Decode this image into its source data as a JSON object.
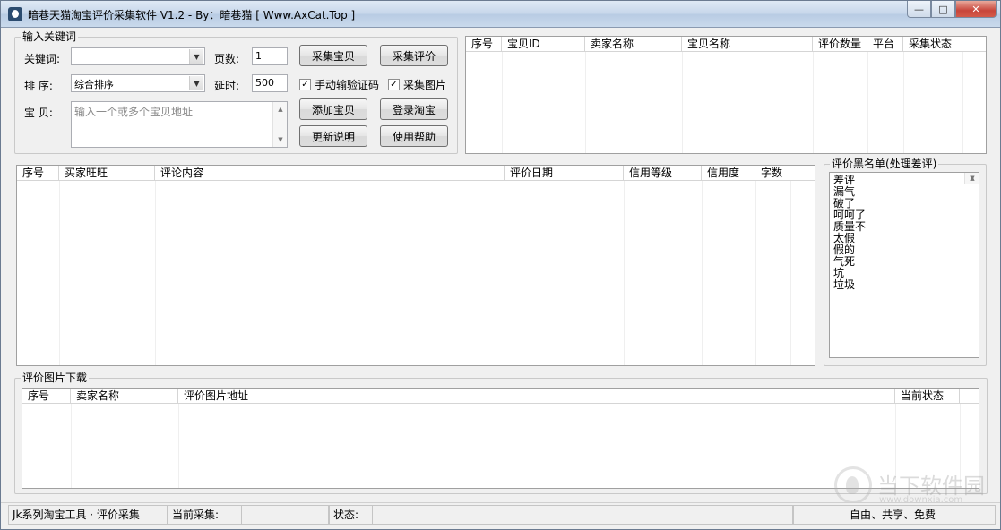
{
  "window": {
    "title": "暗巷天猫淘宝评价采集软件 V1.2 - By：暗巷猫 [ Www.AxCat.Top ]",
    "minimize": "—",
    "maximize": "□",
    "close": "✕"
  },
  "keywords_group": {
    "legend": "输入关键词",
    "keyword_label": "关键词:",
    "keyword_value": "",
    "pages_label": "页数:",
    "pages_value": "1",
    "sort_label": "排 序:",
    "sort_value": "综合排序",
    "delay_label": "延时:",
    "delay_value": "500",
    "item_label": "宝 贝:",
    "item_placeholder": "输入一个或多个宝贝地址",
    "collect_items_btn": "采集宝贝",
    "collect_reviews_btn": "采集评价",
    "manual_captcha_label": "手动输验证码",
    "manual_captcha_checked": true,
    "collect_images_label": "采集图片",
    "collect_images_checked": true,
    "add_item_btn": "添加宝贝",
    "login_btn": "登录淘宝",
    "update_notes_btn": "更新说明",
    "help_btn": "使用帮助"
  },
  "items_list": {
    "columns": [
      "序号",
      "宝贝ID",
      "卖家名称",
      "宝贝名称",
      "评价数量",
      "平台",
      "采集状态"
    ]
  },
  "reviews_list": {
    "columns": [
      "序号",
      "买家旺旺",
      "评论内容",
      "评价日期",
      "信用等级",
      "信用度",
      "字数"
    ]
  },
  "blacklist": {
    "legend": "评价黑名单(处理差评)",
    "items": [
      "差评",
      "漏气",
      "破了",
      "呵呵了",
      "质量不",
      "太假",
      "假的",
      "气死",
      "坑",
      "垃圾"
    ]
  },
  "images_group": {
    "legend": "评价图片下载",
    "columns": [
      "序号",
      "卖家名称",
      "评价图片地址",
      "当前状态"
    ]
  },
  "statusbar": {
    "app": "Jk系列淘宝工具 · 评价采集",
    "current_label": "当前采集:",
    "current_value": "",
    "status_label": "状态:",
    "status_value": "",
    "slogan": "自由、共享、免费"
  },
  "watermark": {
    "text": "当下软件园",
    "url": "www.downxia.com"
  }
}
